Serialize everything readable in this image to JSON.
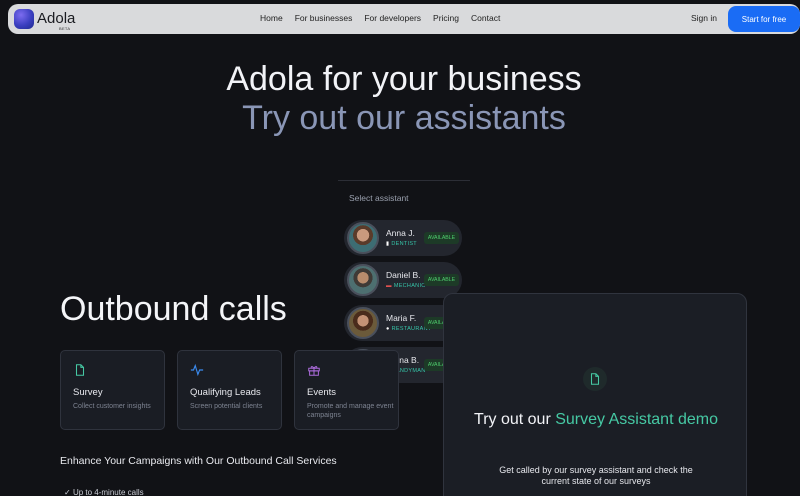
{
  "nav": {
    "logo": "Adola",
    "beta": "BETA",
    "links": [
      "Home",
      "For businesses",
      "For developers",
      "Pricing",
      "Contact"
    ],
    "sign_in": "Sign in",
    "cta": "Start for free"
  },
  "hero": {
    "line1": "Adola for your business",
    "line2": "Try out our assistants"
  },
  "selector": {
    "label": "Select assistant",
    "assistants": [
      {
        "name": "Anna J.",
        "role": "DENTIST",
        "role_icon": "tooth-icon",
        "status": "AVAILABLE"
      },
      {
        "name": "Daniel B.",
        "role": "MECHANIC",
        "role_icon": "car-icon",
        "status": "AVAILABLE"
      },
      {
        "name": "Maria F.",
        "role": "RESTAURANT",
        "role_icon": "food-icon",
        "status": "AVAILABLE"
      },
      {
        "name": "Borna B.",
        "role": "HANDYMAN",
        "role_icon": "hammer-icon",
        "status": "AVAILABLE"
      }
    ]
  },
  "outbound": {
    "title": "Outbound calls",
    "cards": [
      {
        "title": "Survey",
        "desc": "Collect customer insights",
        "icon": "document-icon"
      },
      {
        "title": "Qualifying Leads",
        "desc": "Screen potential clients",
        "icon": "activity-icon"
      },
      {
        "title": "Events",
        "desc": "Promote and manage event campaigns",
        "icon": "gift-icon"
      }
    ],
    "enhance": "Enhance Your Campaigns with Our Outbound Call Services",
    "bullet": "Up to 4-minute calls"
  },
  "demo": {
    "title_prefix": "Try out our ",
    "title_accent": "Survey Assistant demo",
    "desc": "Get called by our survey assistant and check the current state of our surveys"
  },
  "colors": {
    "accent": "#46c9a4",
    "cta": "#1a6cf5",
    "available": "#4fcf6e",
    "background": "#111216"
  }
}
